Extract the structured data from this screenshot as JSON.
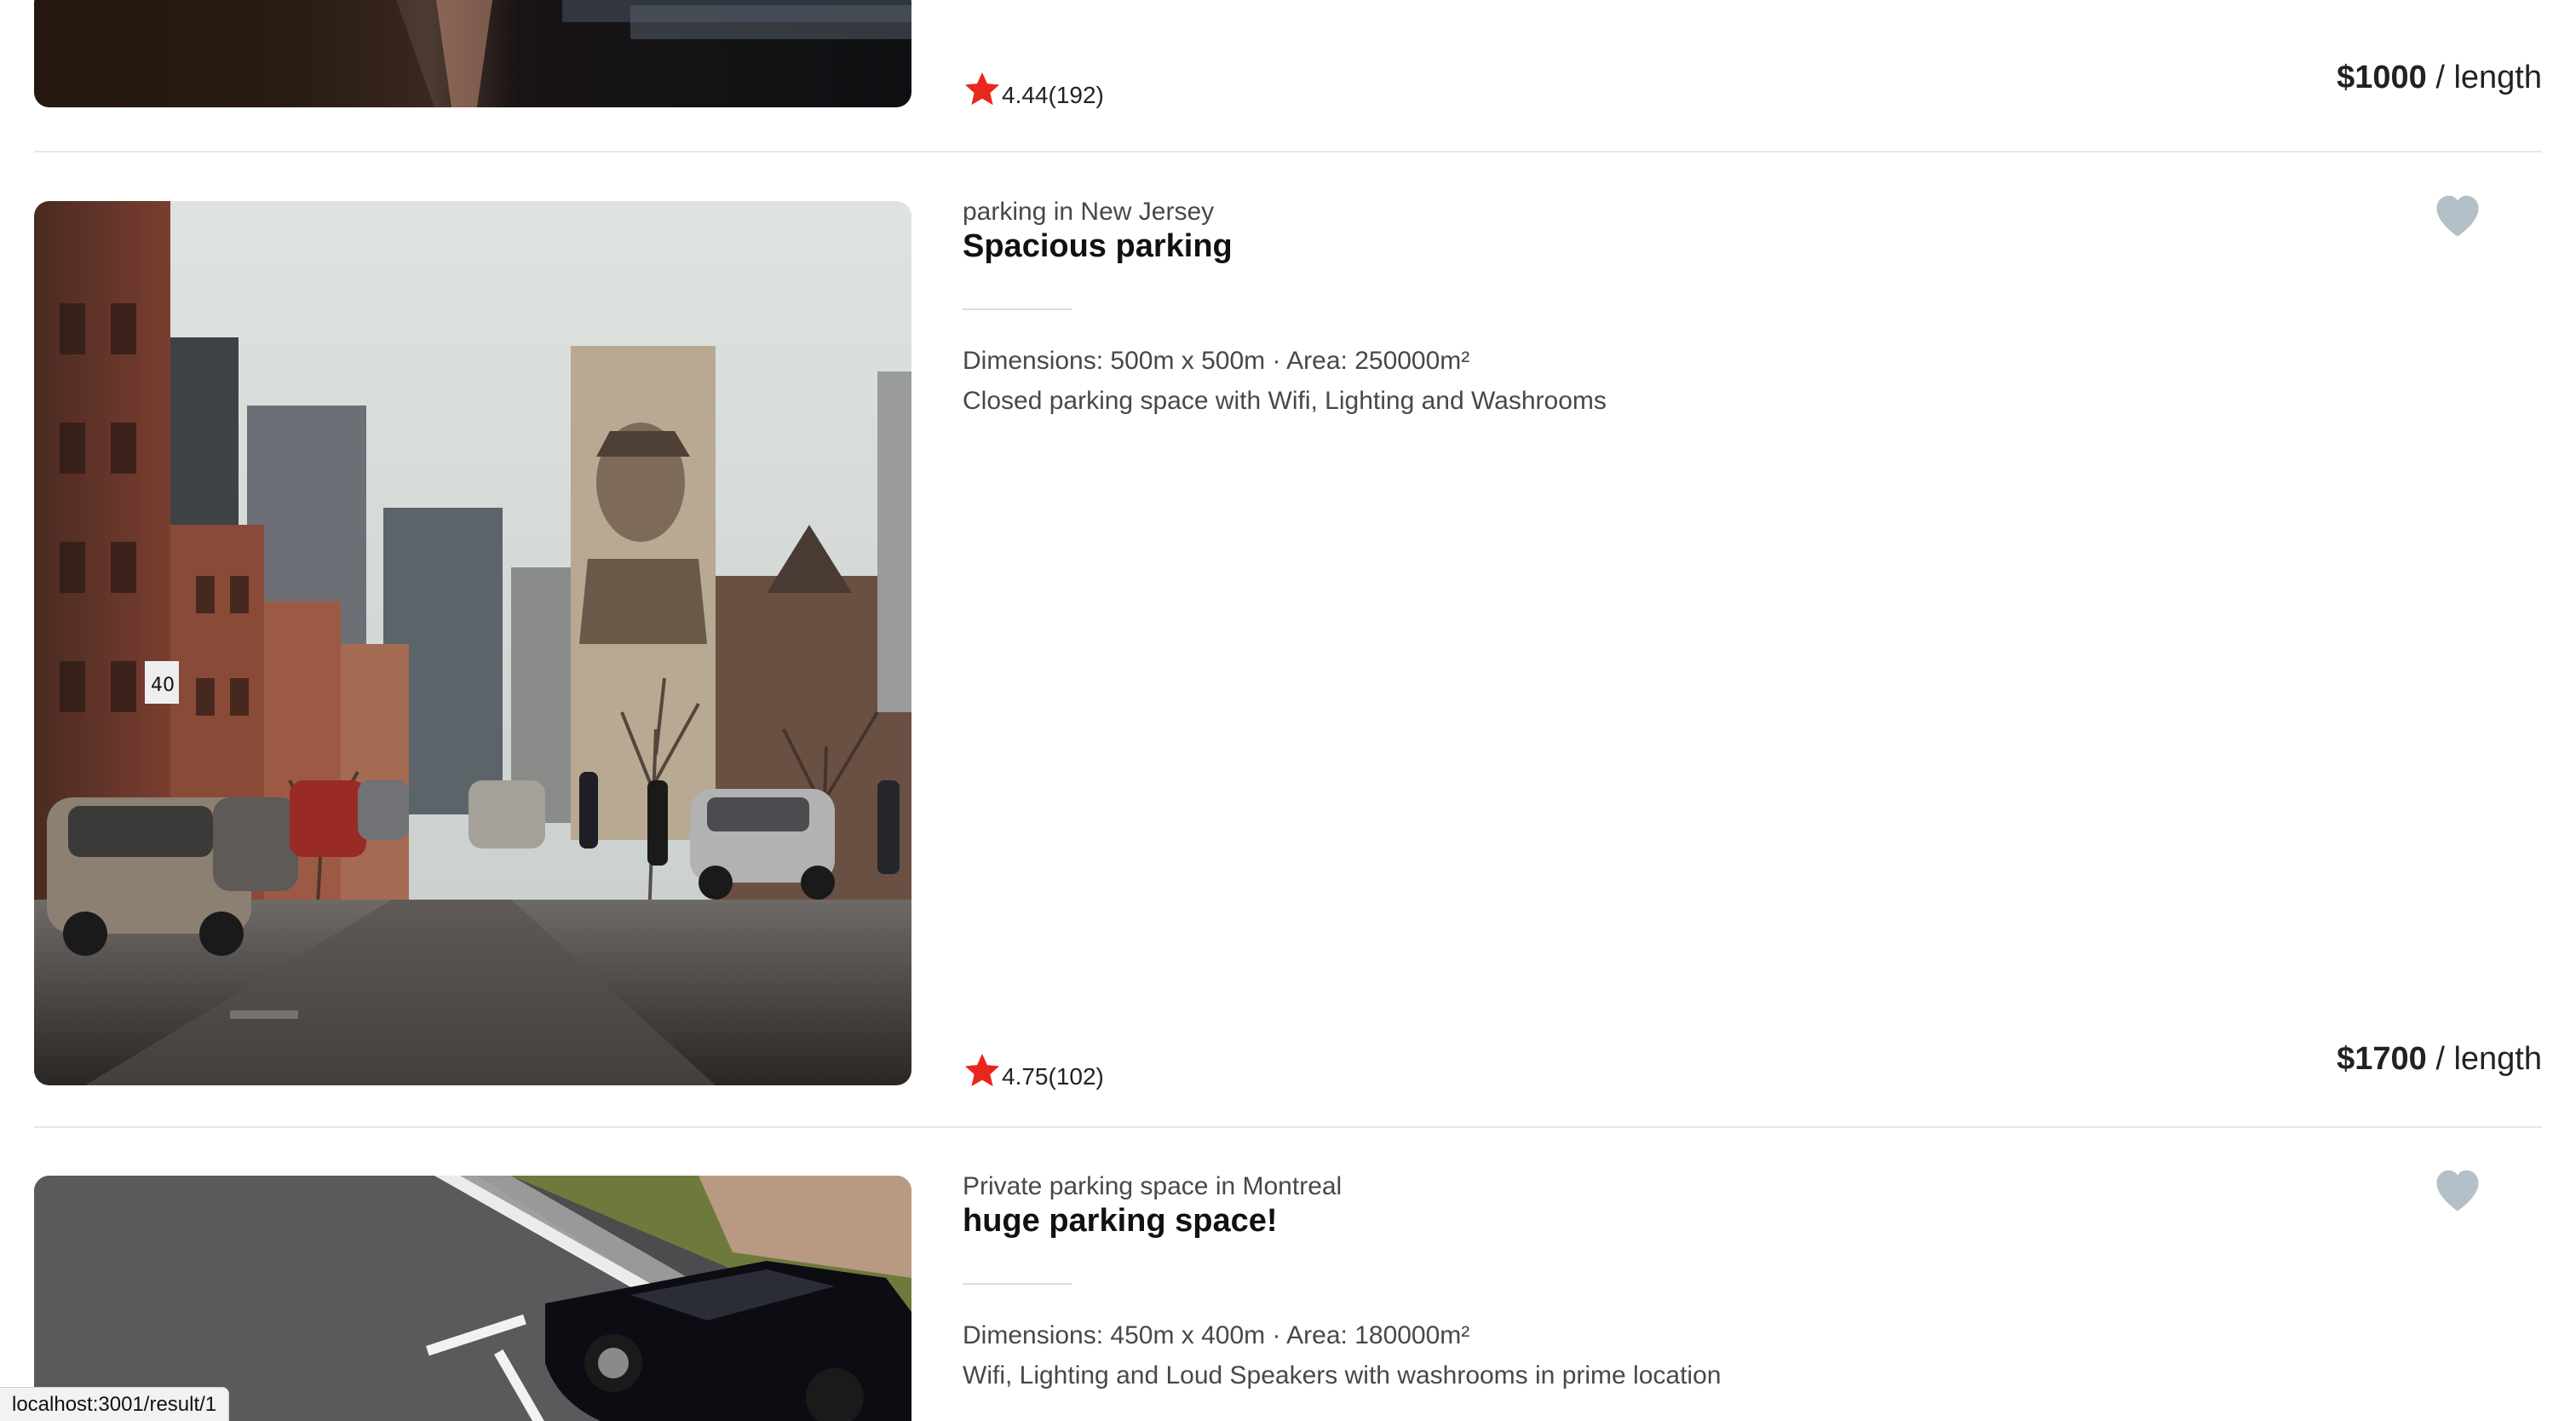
{
  "listings": [
    {
      "location": "",
      "title": "",
      "details_line1": "",
      "details_line2": "",
      "rating": "4.44",
      "reviews": "(192)",
      "price_amount": "$1000",
      "price_unit": " / length",
      "favorite_icon": "heart-icon",
      "image": "partially-visible blurred photo"
    },
    {
      "location": "parking in New Jersey",
      "title": "Spacious parking",
      "details_line1": "Dimensions: 500m x 500m · Area: 250000m²",
      "details_line2": "Closed parking space with Wifi, Lighting and Washrooms",
      "rating": "4.75",
      "reviews": "(102)",
      "price_amount": "$1700",
      "price_unit": " / length",
      "favorite_icon": "heart-icon",
      "image": "city street with parked cars and mural"
    },
    {
      "location": "Private parking space in Montreal",
      "title": "huge parking space!",
      "details_line1": "Dimensions: 450m x 400m · Area: 180000m²",
      "details_line2": "Wifi, Lighting and Loud Speakers with washrooms in prime location",
      "rating": "",
      "reviews": "",
      "price_amount": "",
      "price_unit": "",
      "favorite_icon": "heart-icon",
      "image": "aerial view of black car in parking lot"
    }
  ],
  "colors": {
    "star": "#e8281e",
    "heart": "#b4c0c8",
    "divider": "#e6e6e6"
  },
  "status_bar": {
    "url": "localhost:3001/result/1"
  }
}
